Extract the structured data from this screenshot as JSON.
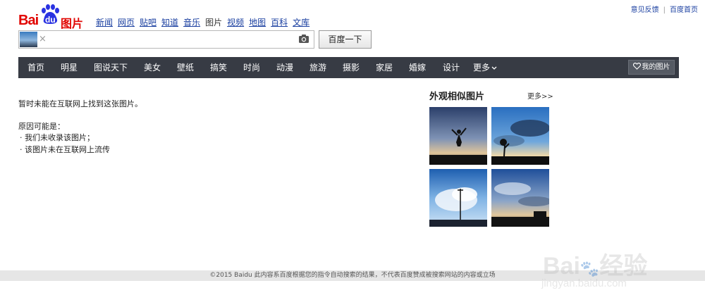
{
  "top_links": [
    "意见反馈",
    "百度首页"
  ],
  "logo": {
    "text_left": "Bai",
    "text_paw": "du",
    "text_right": "图片"
  },
  "top_nav": [
    "新闻",
    "网页",
    "贴吧",
    "知道",
    "音乐",
    "图片",
    "视频",
    "地图",
    "百科",
    "文库"
  ],
  "top_nav_current": "图片",
  "search": {
    "clear": "×",
    "button": "百度一下"
  },
  "categories": [
    "首页",
    "明星",
    "图说天下",
    "美女",
    "壁纸",
    "搞笑",
    "时尚",
    "动漫",
    "旅游",
    "摄影",
    "家居",
    "婚嫁",
    "设计",
    "更多"
  ],
  "my_pictures": "我的图片",
  "not_found": "暂时未能在互联网上找到这张图片。",
  "reasons_title": "原因可能是：",
  "reasons": [
    "我们未收录该图片；",
    "该图片未在互联网上流传"
  ],
  "similar": {
    "title": "外观相似图片",
    "more": "更多>>"
  },
  "footer": "©2015 Baidu 此内容系百度根据您的指令自动搜索的结果，不代表百度赞成被搜索网站的内容或立场",
  "watermark": {
    "line1": "Bai",
    "line1b": "经验",
    "line2": "jingyan.baidu.com"
  },
  "colors": {
    "brand_red": "#e10602",
    "paw_blue": "#2932e1",
    "nav_bar": "#373b44",
    "link_blue": "#1a3fa0"
  }
}
